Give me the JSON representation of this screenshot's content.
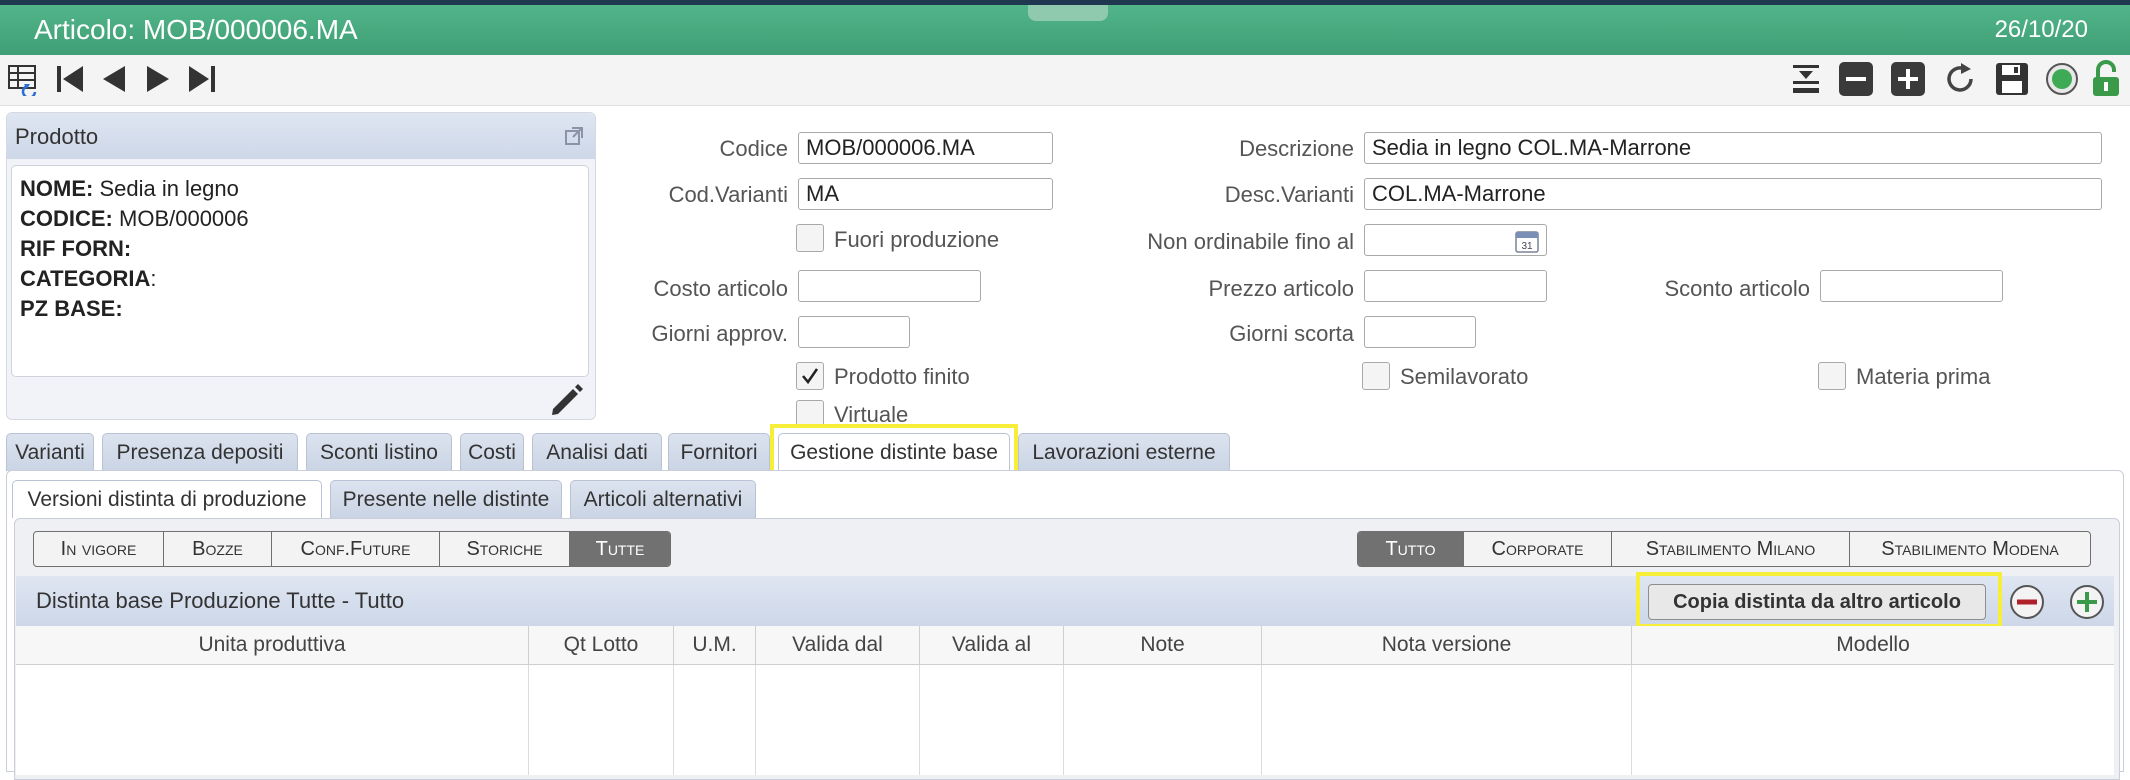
{
  "header": {
    "title": "Articolo: MOB/000006.MA",
    "date": "26/10/20"
  },
  "toolbar": {
    "left_icons": [
      "table-list-icon",
      "first-record-icon",
      "previous-record-icon",
      "next-record-icon",
      "last-record-icon"
    ],
    "right_icons": [
      "insert-row-icon",
      "remove-icon",
      "add-icon",
      "refresh-icon",
      "save-icon",
      "status-icon",
      "unlock-icon"
    ]
  },
  "product_panel": {
    "title": "Prodotto",
    "nome_label": "NOME:",
    "nome_value": " Sedia in legno",
    "codice_label": "CODICE:",
    "codice_value": " MOB/000006",
    "rif_forn_label": "RIF FORN:",
    "rif_forn_value": "",
    "categoria_label": "CATEGORIA",
    "categoria_value": ":",
    "pz_base_label": "PZ BASE:",
    "pz_base_value": ""
  },
  "form": {
    "codice_label": "Codice",
    "codice_value": "MOB/000006.MA",
    "descrizione_label": "Descrizione",
    "descrizione_value": "Sedia in legno COL.MA-Marrone",
    "cod_varianti_label": "Cod.Varianti",
    "cod_varianti_value": "MA",
    "desc_varianti_label": "Desc.Varianti",
    "desc_varianti_value": "COL.MA-Marrone",
    "fuori_produzione_label": "Fuori produzione",
    "fuori_produzione_checked": false,
    "non_ordinabile_label": "Non ordinabile fino al",
    "non_ordinabile_value": "",
    "calendar_day": "31",
    "costo_label": "Costo articolo",
    "costo_value": "",
    "prezzo_label": "Prezzo articolo",
    "prezzo_value": "",
    "sconto_label": "Sconto articolo",
    "sconto_value": "",
    "giorni_approv_label": "Giorni approv.",
    "giorni_approv_value": "",
    "giorni_scorta_label": "Giorni scorta",
    "giorni_scorta_value": "",
    "prodotto_finito_label": "Prodotto finito",
    "prodotto_finito_checked": true,
    "semilavorato_label": "Semilavorato",
    "semilavorato_checked": false,
    "materia_prima_label": "Materia prima",
    "materia_prima_checked": false,
    "virtuale_label": "Virtuale",
    "virtuale_checked": false
  },
  "tabs": [
    "Varianti",
    "Presenza depositi",
    "Sconti listino",
    "Costi",
    "Analisi dati",
    "Fornitori",
    "Gestione distinte base",
    "Lavorazioni esterne"
  ],
  "active_tab": "Gestione distinte base",
  "subtabs": [
    "Versioni distinta di produzione",
    "Presente nelle distinte",
    "Articoli alternativi"
  ],
  "active_subtab": "Versioni distinta di produzione",
  "filters_state": [
    "In vigore",
    "Bozze",
    "Conf.Future",
    "Storiche",
    "Tutte"
  ],
  "filters_state_selected": "Tutte",
  "filters_site": [
    "Tutto",
    "Corporate",
    "Stabilimento Milano",
    "Stabilimento Modena"
  ],
  "filters_site_selected": "Tutto",
  "grid": {
    "title": "Distinta base Produzione Tutte - Tutto",
    "copy_button": "Copia distinta da altro articolo",
    "columns": [
      "Unita produttiva",
      "Qt Lotto",
      "U.M.",
      "Valida dal",
      "Valida al",
      "Note",
      "Nota versione",
      "Modello"
    ],
    "rows": []
  },
  "colors": {
    "title_bar": "#4aad80",
    "highlight": "#f7ee39",
    "accent_panel": "#d6deec"
  }
}
